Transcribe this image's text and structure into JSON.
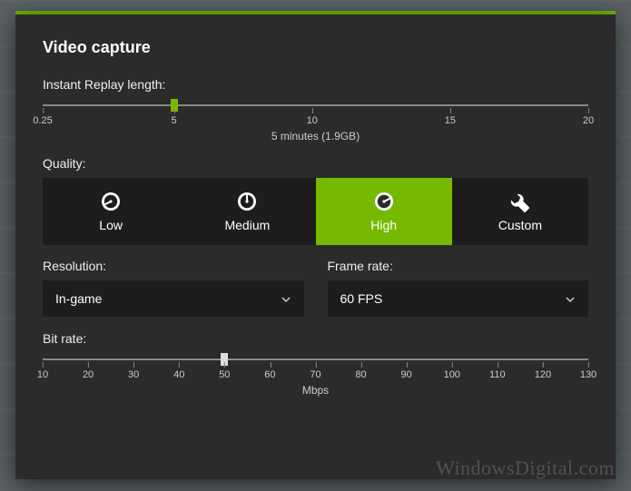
{
  "accent_color": "#76b900",
  "title": "Video capture",
  "replay": {
    "label": "Instant Replay length:",
    "min": 0.25,
    "max": 20,
    "value": 5,
    "ticks": [
      {
        "pos": 0,
        "label": "0.25"
      },
      {
        "pos": 24.05,
        "label": "5"
      },
      {
        "pos": 49.37,
        "label": "10"
      },
      {
        "pos": 74.68,
        "label": "15"
      },
      {
        "pos": 100,
        "label": "20"
      }
    ],
    "thumb_pos_pct": 24.05,
    "caption": "5 minutes (1.9GB)"
  },
  "quality": {
    "label": "Quality:",
    "options": [
      {
        "id": "low",
        "label": "Low",
        "icon": "gauge-low-icon",
        "selected": false
      },
      {
        "id": "medium",
        "label": "Medium",
        "icon": "gauge-mid-icon",
        "selected": false
      },
      {
        "id": "high",
        "label": "High",
        "icon": "gauge-high-icon",
        "selected": true
      },
      {
        "id": "custom",
        "label": "Custom",
        "icon": "wrench-icon",
        "selected": false
      }
    ]
  },
  "resolution": {
    "label": "Resolution:",
    "value": "In-game"
  },
  "framerate": {
    "label": "Frame rate:",
    "value": "60 FPS"
  },
  "bitrate": {
    "label": "Bit rate:",
    "min": 10,
    "max": 130,
    "value": 50,
    "unit": "Mbps",
    "ticks": [
      {
        "pos": 0,
        "label": "10"
      },
      {
        "pos": 8.33,
        "label": "20"
      },
      {
        "pos": 16.67,
        "label": "30"
      },
      {
        "pos": 25,
        "label": "40"
      },
      {
        "pos": 33.33,
        "label": "50"
      },
      {
        "pos": 41.67,
        "label": "60"
      },
      {
        "pos": 50,
        "label": "70"
      },
      {
        "pos": 58.33,
        "label": "80"
      },
      {
        "pos": 66.67,
        "label": "90"
      },
      {
        "pos": 75,
        "label": "100"
      },
      {
        "pos": 83.33,
        "label": "110"
      },
      {
        "pos": 91.67,
        "label": "120"
      },
      {
        "pos": 100,
        "label": "130"
      }
    ],
    "thumb_pos_pct": 33.33
  },
  "watermark": "WindowsDigital.com"
}
